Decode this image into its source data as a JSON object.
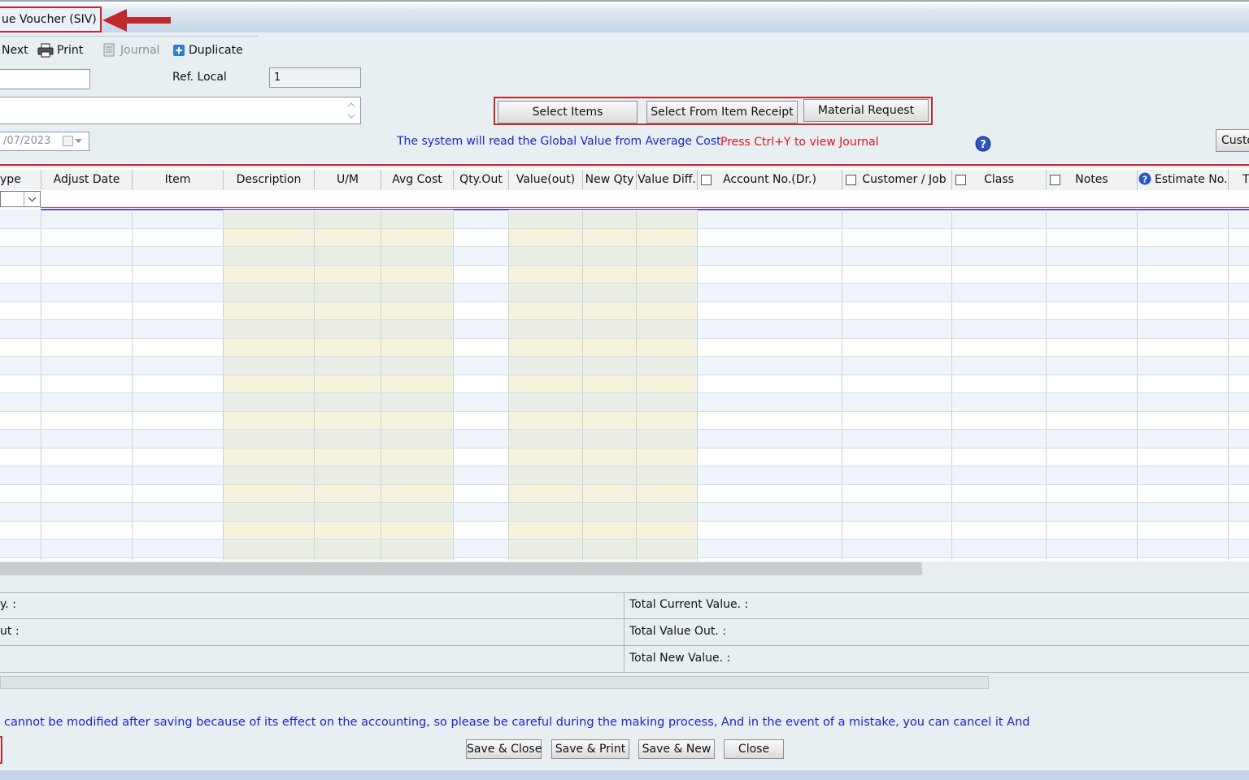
{
  "window": {
    "title": "ue Voucher (SIV)"
  },
  "toolbar": {
    "next_label": "Next",
    "print_label": "Print",
    "journal_label": "Journal",
    "duplicate_label": "Duplicate"
  },
  "form": {
    "ref_local_label": "Ref. Local",
    "ref_local_value": "1",
    "date_value": "/07/2023"
  },
  "actions": {
    "select_items": "Select Items",
    "select_from_receipt": "Select From Item Receipt",
    "material_request": "Material Request",
    "custom_button": "Custo"
  },
  "notes": {
    "global_value": "The system will read the Global Value from Average Cost",
    "ctrl_y": "Press Ctrl+Y to view Journal"
  },
  "table": {
    "columns": [
      "ype",
      "Adjust Date",
      "Item",
      "Description",
      "U/M",
      "Avg Cost",
      "Qty.Out",
      "Value(out)",
      "New Qty",
      "Value Diff.",
      "Account No.(Dr.)",
      "Customer / Job",
      "Class",
      "Notes",
      "Estimate No.",
      "T"
    ]
  },
  "totals": {
    "left1": "y. :",
    "left2": "ut :",
    "total_current": "Total Current Value. :",
    "total_value_out": "Total Value Out. :",
    "total_new": "Total New Value. :"
  },
  "footer": {
    "warning": "cannot be modified after saving because of its effect on the accounting, so please be careful during the making process, And in the event of a mistake, you can cancel it And",
    "save_close": "Save & Close",
    "save_print": "Save & Print",
    "save_new": "Save & New",
    "close": "Close"
  },
  "colors": {
    "highlight_red": "#c0282d",
    "note_blue": "#1d25c9",
    "note_red": "#e0141e",
    "yellow_col": "#f6f3dc"
  }
}
